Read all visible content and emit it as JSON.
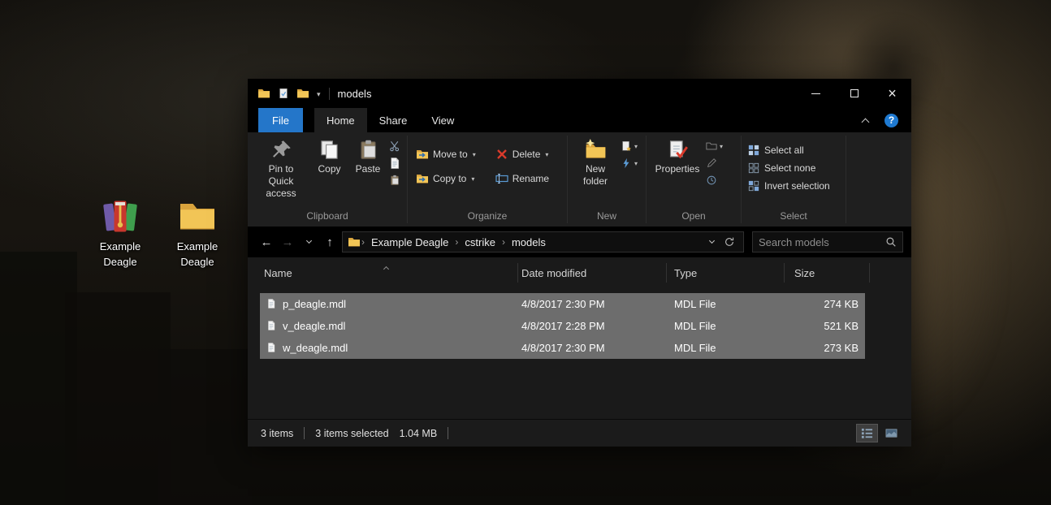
{
  "desktop": {
    "icons": [
      {
        "label": "Example Deagle",
        "kind": "winrar-archive"
      },
      {
        "label": "Example Deagle",
        "kind": "folder"
      }
    ]
  },
  "colors": {
    "accent_blue": "#2476c9",
    "selection_gray": "#6d6d6d",
    "delete_red": "#d93a2b",
    "folder_yellow": "#f2c556"
  },
  "window": {
    "title": "models",
    "tabs": [
      {
        "label": "File"
      },
      {
        "label": "Home"
      },
      {
        "label": "Share"
      },
      {
        "label": "View"
      }
    ],
    "ribbon": {
      "clipboard": {
        "label": "Clipboard",
        "pin": "Pin to Quick access",
        "copy": "Copy",
        "paste": "Paste"
      },
      "organize": {
        "label": "Organize",
        "move_to": "Move to",
        "copy_to": "Copy to",
        "delete": "Delete",
        "rename": "Rename"
      },
      "new": {
        "label": "New",
        "new_folder": "New folder"
      },
      "open": {
        "label": "Open",
        "properties": "Properties"
      },
      "select": {
        "label": "Select",
        "select_all": "Select all",
        "select_none": "Select none",
        "invert": "Invert selection"
      }
    },
    "navbar": {
      "crumbs": [
        "Example Deagle",
        "cstrike",
        "models"
      ],
      "search_placeholder": "Search models"
    },
    "list": {
      "columns": {
        "name": "Name",
        "modified": "Date modified",
        "type": "Type",
        "size": "Size"
      },
      "rows": [
        {
          "name": "p_deagle.mdl",
          "modified": "4/8/2017 2:30 PM",
          "type": "MDL File",
          "size": "274 KB"
        },
        {
          "name": "v_deagle.mdl",
          "modified": "4/8/2017 2:28 PM",
          "type": "MDL File",
          "size": "521 KB"
        },
        {
          "name": "w_deagle.mdl",
          "modified": "4/8/2017 2:30 PM",
          "type": "MDL File",
          "size": "273 KB"
        }
      ]
    },
    "statusbar": {
      "items": "3 items",
      "selected": "3 items selected",
      "size": "1.04 MB"
    }
  }
}
